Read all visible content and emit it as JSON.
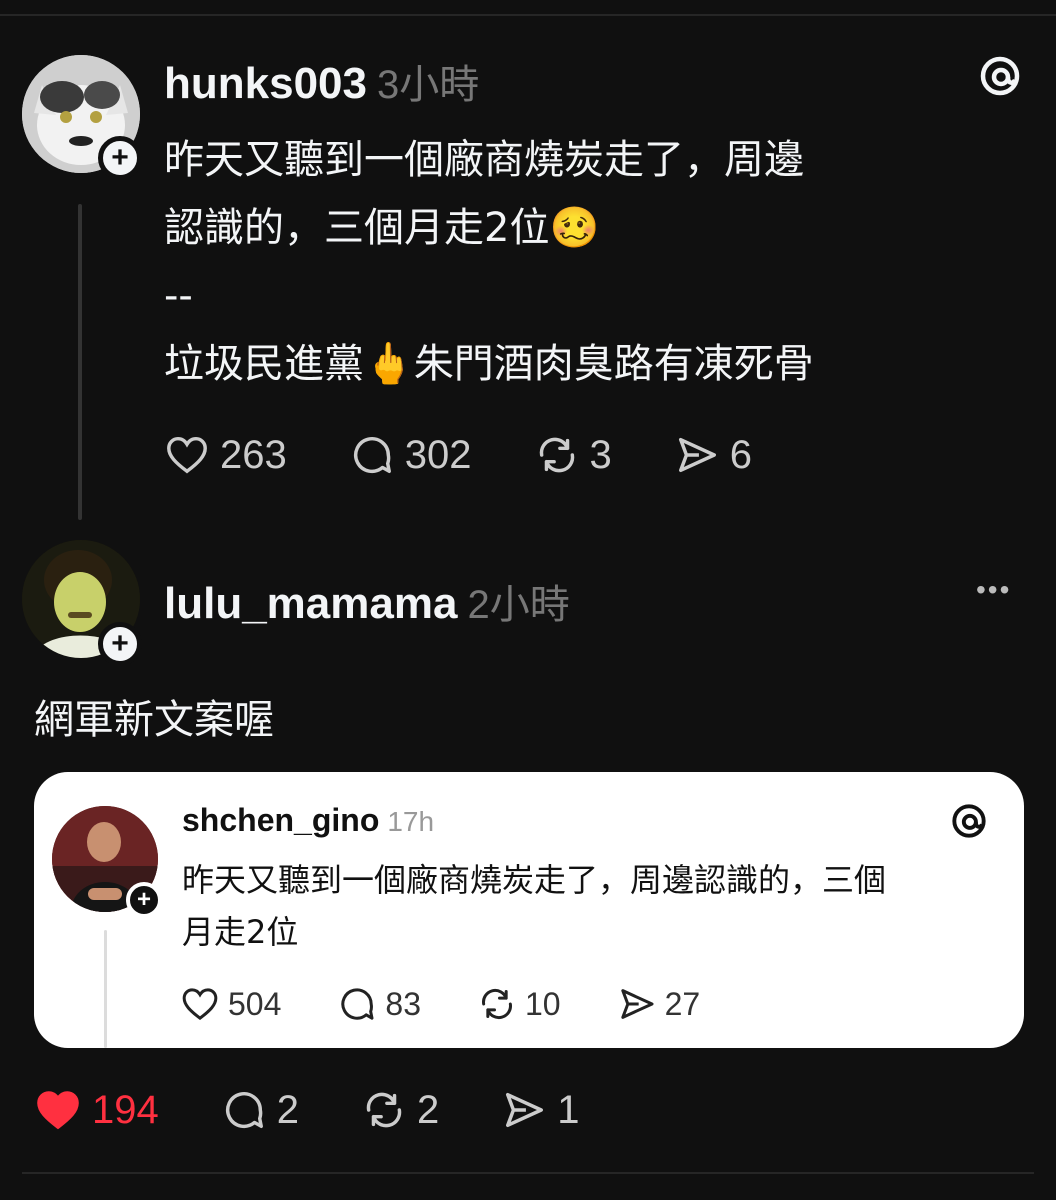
{
  "post": {
    "username": "hunks003",
    "time": "3小時",
    "line1": "昨天又聽到一個廠商燒炭走了，周邊",
    "line2": "認識的，三個月走2位🥴",
    "line3": "--",
    "line4": "垃圾民進黨🖕朱門酒肉臭路有凍死骨",
    "likes": "263",
    "replies": "302",
    "reposts": "3",
    "shares": "6"
  },
  "reply": {
    "username": "lulu_mamama",
    "time": "2小時",
    "text": "網軍新文案喔",
    "likes": "194",
    "replies": "2",
    "reposts": "2",
    "shares": "1"
  },
  "quoted": {
    "username": "shchen_gino",
    "time": "17h",
    "line1": "昨天又聽到一個廠商燒炭走了，周邊認識的，三個",
    "line2": "月走2位",
    "likes": "504",
    "replies": "83",
    "reposts": "10",
    "shares": "27"
  },
  "icons": {
    "plus": "+",
    "threads_logo": "@",
    "more": "•••"
  },
  "colors": {
    "background": "#101010",
    "liked": "#ff3040",
    "text": "#f3f5f7",
    "muted": "#777777"
  }
}
